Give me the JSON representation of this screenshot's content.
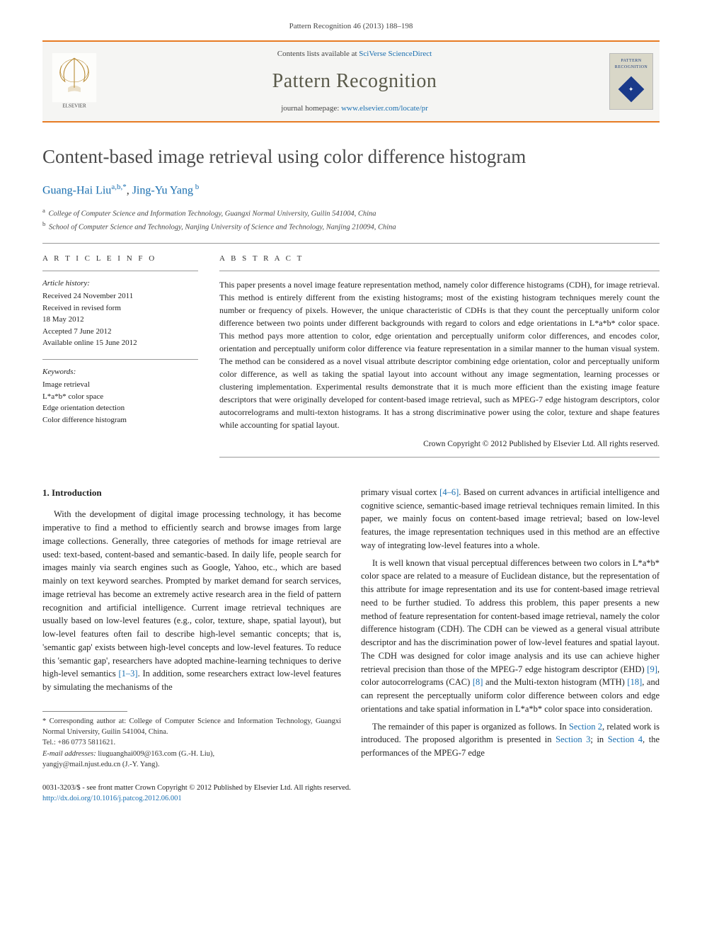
{
  "citation": "Pattern Recognition 46 (2013) 188–198",
  "header": {
    "contents_prefix": "Contents lists available at ",
    "contents_link": "SciVerse ScienceDirect",
    "journal_name": "Pattern Recognition",
    "homepage_prefix": "journal homepage: ",
    "homepage_link": "www.elsevier.com/locate/pr",
    "publisher": "ELSEVIER",
    "cover_line1": "PATTERN",
    "cover_line2": "RECOGNITION"
  },
  "title": "Content-based image retrieval using color difference histogram",
  "authors_html": "Guang-Hai Liu",
  "author1_sup": "a,b,",
  "author1_star": "*",
  "author_sep": ", ",
  "author2": "Jing-Yu Yang",
  "author2_sup": " b",
  "affiliations": {
    "a": "College of Computer Science and Information Technology, Guangxi Normal University, Guilin 541004, China",
    "b": "School of Computer Science and Technology, Nanjing University of Science and Technology, Nanjing 210094, China"
  },
  "article_info_head": "A R T I C L E  I N F O",
  "abstract_head": "A B S T R A C T",
  "history": {
    "label": "Article history:",
    "received": "Received 24 November 2011",
    "revised1": "Received in revised form",
    "revised2": "18 May 2012",
    "accepted": "Accepted 7 June 2012",
    "online": "Available online 15 June 2012"
  },
  "keywords": {
    "label": "Keywords:",
    "items": [
      "Image retrieval",
      "L*a*b* color space",
      "Edge orientation detection",
      "Color difference histogram"
    ]
  },
  "abstract": "This paper presents a novel image feature representation method, namely color difference histograms (CDH), for image retrieval. This method is entirely different from the existing histograms; most of the existing histogram techniques merely count the number or frequency of pixels. However, the unique characteristic of CDHs is that they count the perceptually uniform color difference between two points under different backgrounds with regard to colors and edge orientations in L*a*b* color space. This method pays more attention to color, edge orientation and perceptually uniform color differences, and encodes color, orientation and perceptually uniform color difference via feature representation in a similar manner to the human visual system. The method can be considered as a novel visual attribute descriptor combining edge orientation, color and perceptually uniform color difference, as well as taking the spatial layout into account without any image segmentation, learning processes or clustering implementation. Experimental results demonstrate that it is much more efficient than the existing image feature descriptors that were originally developed for content-based image retrieval, such as MPEG-7 edge histogram descriptors, color autocorrelograms and multi-texton histograms. It has a strong discriminative power using the color, texture and shape features while accounting for spatial layout.",
  "copyright": "Crown Copyright © 2012 Published by Elsevier Ltd. All rights reserved.",
  "section1_title": "1.  Introduction",
  "col1_p1a": "With the development of digital image processing technology, it has become imperative to find a method to efficiently search and browse images from large image collections. Generally, three categories of methods for image retrieval are used: text-based, content-based and semantic-based. In daily life, people search for images mainly via search engines such as Google, Yahoo, etc., which are based mainly on text keyword searches. Prompted by market demand for search services, image retrieval has become an extremely active research area in the field of pattern recognition and artificial intelligence. Current image retrieval techniques are usually based on low-level features (e.g., color, texture, shape, spatial layout), but low-level features often fail to describe high-level semantic concepts; that is, 'semantic gap' exists between high-level concepts and low-level features. To reduce this 'semantic gap', researchers have adopted machine-learning techniques to derive high-level semantics ",
  "col1_ref1": "[1–3]",
  "col1_p1b": ". In addition, some researchers extract low-level features by simulating the mechanisms of the",
  "col2_p1a": "primary visual cortex ",
  "col2_ref1": "[4–6]",
  "col2_p1b": ". Based on current advances in artificial intelligence and cognitive science, semantic-based image retrieval techniques remain limited. In this paper, we mainly focus on content-based image retrieval; based on low-level features, the image representation techniques used in this method are an effective way of integrating low-level features into a whole.",
  "col2_p2a": "It is well known that visual perceptual differences between two colors in L*a*b* color space are related to a measure of Euclidean distance, but the representation of this attribute for image representation and its use for content-based image retrieval need to be further studied. To address this problem, this paper presents a new method of feature representation for content-based image retrieval, namely the color difference histogram (CDH). The CDH can be viewed as a general visual attribute descriptor and has the discrimination power of low-level features and spatial layout. The CDH was designed for color image analysis and its use can achieve higher retrieval precision than those of the MPEG-7 edge histogram descriptor (EHD) ",
  "col2_ref2": "[9]",
  "col2_p2b": ", color autocorrelograms (CAC) ",
  "col2_ref3": "[8]",
  "col2_p2c": " and the Multi-texton histogram (MTH) ",
  "col2_ref4": "[18]",
  "col2_p2d": ", and can represent the perceptually uniform color difference between colors and edge orientations and take spatial information in L*a*b* color space into consideration.",
  "col2_p3a": "The remainder of this paper is organized as follows. In ",
  "col2_sec2": "Section 2",
  "col2_p3b": ", related work is introduced. The proposed algorithm is presented in ",
  "col2_sec3": "Section 3",
  "col2_p3c": "; in ",
  "col2_sec4": "Section 4",
  "col2_p3d": ", the performances of the MPEG-7 edge",
  "footnotes": {
    "corr_label": "* Corresponding author at: College of Computer Science and Information Technology, Guangxi Normal University, Guilin 541004, China.",
    "tel": "Tel.: +86 0773 5811621.",
    "email_label": "E-mail addresses:",
    "email1": " liuguanghai009@163.com (G.-H. Liu),",
    "email2": "yangjy@mail.njust.edu.cn (J.-Y. Yang)."
  },
  "footer": {
    "issn": "0031-3203/$ - see front matter Crown Copyright © 2012 Published by Elsevier Ltd. All rights reserved.",
    "doi": "http://dx.doi.org/10.1016/j.patcog.2012.06.001"
  }
}
